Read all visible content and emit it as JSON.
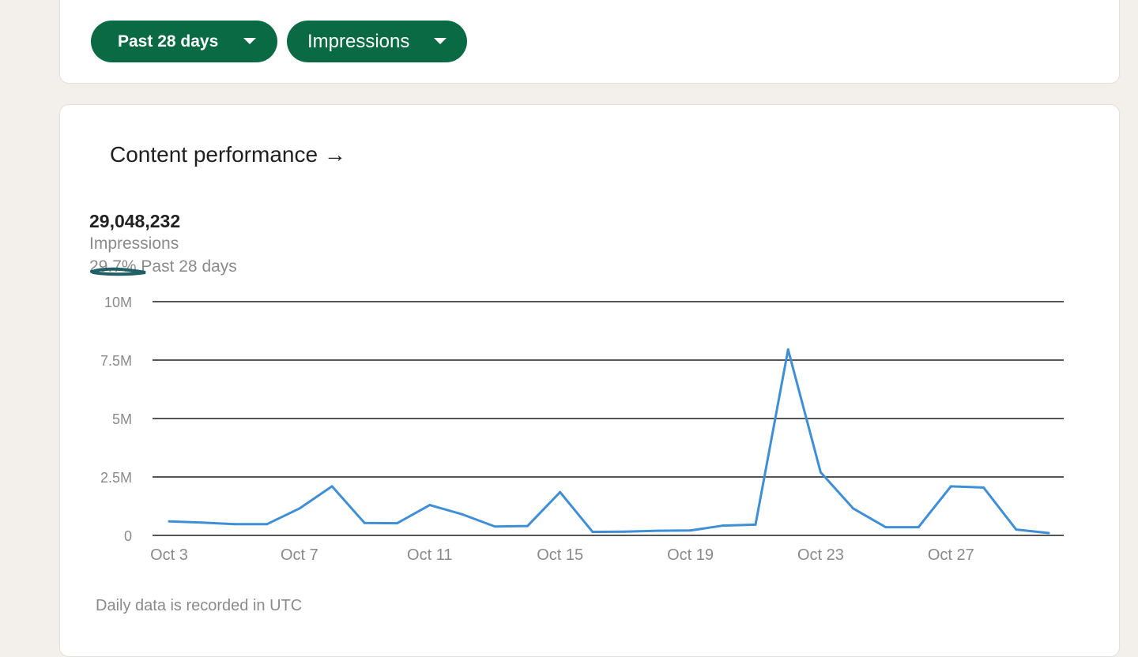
{
  "filters": {
    "date_range": "Past 28 days",
    "metric": "Impressions"
  },
  "content_performance": {
    "title": "Content performance →",
    "total_value": "29,048,232",
    "metric_label": "Impressions",
    "change_percent": "29.7%",
    "change_period": "Past 28 days",
    "footnote": "Daily data is recorded in UTC"
  },
  "colors": {
    "accent_green": "#0a6a44",
    "line_blue": "#3f8fd6",
    "grid": "#555555"
  },
  "chart_data": {
    "type": "line",
    "title": "",
    "xlabel": "",
    "ylabel": "",
    "ylim": [
      0,
      10000000
    ],
    "grid": true,
    "y_ticks": [
      {
        "value": 10000000,
        "label": "10M"
      },
      {
        "value": 7500000,
        "label": "7.5M"
      },
      {
        "value": 5000000,
        "label": "5M"
      },
      {
        "value": 2500000,
        "label": "2.5M"
      },
      {
        "value": 0,
        "label": "0"
      }
    ],
    "x_tick_labels": [
      "Oct 3",
      "Oct 7",
      "Oct 11",
      "Oct 15",
      "Oct 19",
      "Oct 23",
      "Oct 27"
    ],
    "x_tick_days": [
      3,
      7,
      11,
      15,
      19,
      23,
      27
    ],
    "x": [
      3,
      4,
      5,
      6,
      7,
      8,
      9,
      10,
      11,
      12,
      13,
      14,
      15,
      16,
      17,
      18,
      19,
      20,
      21,
      22,
      23,
      24,
      25,
      26,
      27,
      28,
      29,
      30
    ],
    "series": [
      {
        "values": [
          600000,
          550000,
          480000,
          480000,
          1150000,
          2100000,
          530000,
          520000,
          1300000,
          900000,
          380000,
          400000,
          1850000,
          150000,
          160000,
          200000,
          210000,
          420000,
          460000,
          7950000,
          2700000,
          1150000,
          350000,
          350000,
          2100000,
          2050000,
          250000,
          100000
        ]
      }
    ]
  }
}
